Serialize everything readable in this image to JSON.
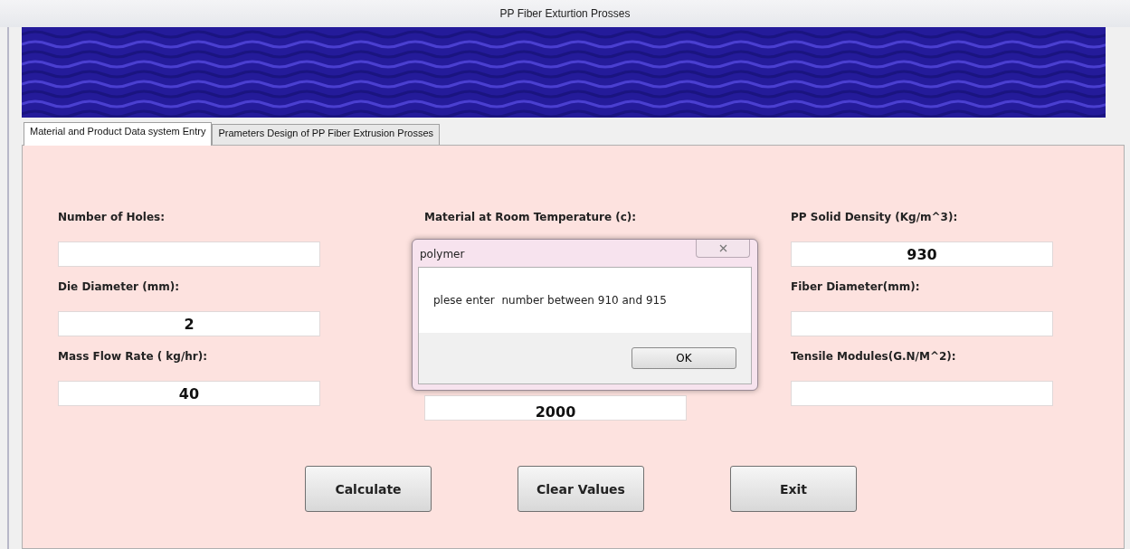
{
  "window": {
    "title": "PP Fiber Exturtion Prosses"
  },
  "tabs": [
    {
      "label": "Material and Product Data system Entry",
      "selected": true
    },
    {
      "label": "Prameters Design of PP Fiber Extrusion Prosses",
      "selected": false
    }
  ],
  "columns": [
    {
      "items": [
        {
          "kind": "label",
          "text": "Number of Holes:"
        },
        {
          "kind": "field"
        },
        {
          "kind": "label",
          "text": "Die Diameter (mm):"
        },
        {
          "kind": "field",
          "value": "2"
        },
        {
          "kind": "label",
          "text": "Mass Flow Rate ( kg/hr):"
        },
        {
          "kind": "field",
          "value": "40"
        }
      ]
    },
    {
      "items": [
        {
          "kind": "label",
          "text": "Material at Room Temperature (c):"
        },
        {
          "kind": "field",
          "value": "2000"
        }
      ]
    },
    {
      "items": [
        {
          "kind": "label",
          "text": "PP Solid Density (Kg/m^3):"
        },
        {
          "kind": "field",
          "value": "930"
        },
        {
          "kind": "label",
          "text": "Fiber Diameter(mm):"
        },
        {
          "kind": "field"
        },
        {
          "kind": "label",
          "text": "Tensile Modules(G.N/M^2):"
        },
        {
          "kind": "field"
        }
      ]
    }
  ],
  "buttons": [
    "Calculate",
    "Clear Values",
    "Exit"
  ],
  "dialog": {
    "title": "polymer",
    "message": "plese enter  number between 910 and 915",
    "button": "OK"
  }
}
